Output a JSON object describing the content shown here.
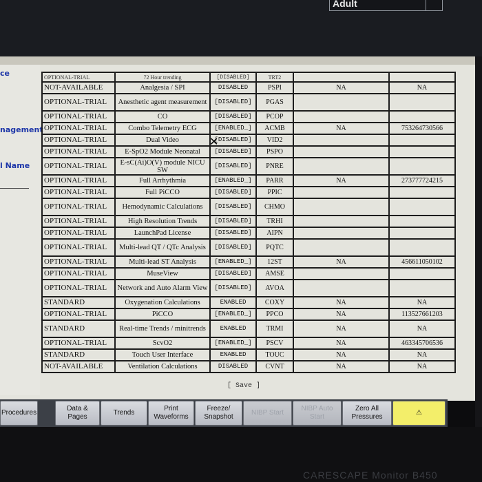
{
  "header": {
    "patient_type": "Adult"
  },
  "left_panel": {
    "labels": [
      "ce",
      "nagement",
      "l Name"
    ]
  },
  "table": {
    "rows": [
      {
        "status": "OPTIONAL-TRIAL",
        "feature": "72 Hour trending",
        "state": "[DISABLED]",
        "code": "TRT2",
        "v1": "",
        "v2": ""
      },
      {
        "status": "NOT-AVAILABLE",
        "feature": "Analgesia / SPI",
        "state": "DISABLED",
        "code": "PSPI",
        "v1": "NA",
        "v2": "NA"
      },
      {
        "status": "OPTIONAL-TRIAL",
        "feature": "Anesthetic agent measurement",
        "state": "[DISABLED]",
        "code": "PGAS",
        "v1": "",
        "v2": ""
      },
      {
        "status": "OPTIONAL-TRIAL",
        "feature": "CO",
        "state": "[DISABLED]",
        "code": "PCOP",
        "v1": "",
        "v2": ""
      },
      {
        "status": "OPTIONAL-TRIAL",
        "feature": "Combo Telemetry ECG",
        "state": "[ENABLED_]",
        "code": "ACMB",
        "v1": "NA",
        "v2": "753264730566"
      },
      {
        "status": "OPTIONAL-TRIAL",
        "feature": "Dual Video",
        "state": "[DISABLED]",
        "code": "VID2",
        "v1": "",
        "v2": ""
      },
      {
        "status": "OPTIONAL-TRIAL",
        "feature": "E-SpO2 Module Neonatal",
        "state": "[DISABLED]",
        "code": "PSPO",
        "v1": "",
        "v2": ""
      },
      {
        "status": "OPTIONAL-TRIAL",
        "feature": "E-sC(Ai)O(V) module NICU SW",
        "state": "[DISABLED]",
        "code": "PNRE",
        "v1": "",
        "v2": ""
      },
      {
        "status": "OPTIONAL-TRIAL",
        "feature": "Full Arrhythmia",
        "state": "[ENABLED_]",
        "code": "PARR",
        "v1": "NA",
        "v2": "273777724215"
      },
      {
        "status": "OPTIONAL-TRIAL",
        "feature": "Full PiCCO",
        "state": "[DISABLED]",
        "code": "PPIC",
        "v1": "",
        "v2": ""
      },
      {
        "status": "OPTIONAL-TRIAL",
        "feature": "Hemodynamic Calculations",
        "state": "[DISABLED]",
        "code": "CHMO",
        "v1": "",
        "v2": ""
      },
      {
        "status": "OPTIONAL-TRIAL",
        "feature": "High Resolution Trends",
        "state": "[DISABLED]",
        "code": "TRHI",
        "v1": "",
        "v2": ""
      },
      {
        "status": "OPTIONAL-TRIAL",
        "feature": "LaunchPad License",
        "state": "[DISABLED]",
        "code": "AIPN",
        "v1": "",
        "v2": ""
      },
      {
        "status": "OPTIONAL-TRIAL",
        "feature": "Multi-lead QT / QTc Analysis",
        "state": "[DISABLED]",
        "code": "PQTC",
        "v1": "",
        "v2": ""
      },
      {
        "status": "OPTIONAL-TRIAL",
        "feature": "Multi-lead ST Analysis",
        "state": "[ENABLED_]",
        "code": "12ST",
        "v1": "NA",
        "v2": "456611050102"
      },
      {
        "status": "OPTIONAL-TRIAL",
        "feature": "MuseView",
        "state": "[DISABLED]",
        "code": "AMSE",
        "v1": "",
        "v2": ""
      },
      {
        "status": "OPTIONAL-TRIAL",
        "feature": "Network and Auto Alarm View",
        "state": "[DISABLED]",
        "code": "AVOA",
        "v1": "",
        "v2": ""
      },
      {
        "status": "STANDARD",
        "feature": "Oxygenation Calculations",
        "state": "ENABLED",
        "code": "COXY",
        "v1": "NA",
        "v2": "NA"
      },
      {
        "status": "OPTIONAL-TRIAL",
        "feature": "PiCCO",
        "state": "[ENABLED_]",
        "code": "PPCO",
        "v1": "NA",
        "v2": "113527661203"
      },
      {
        "status": "STANDARD",
        "feature": "Real-time Trends / minitrends",
        "state": "ENABLED",
        "code": "TRMI",
        "v1": "NA",
        "v2": "NA"
      },
      {
        "status": "OPTIONAL-TRIAL",
        "feature": "ScvO2",
        "state": "[ENABLED_]",
        "code": "PSCV",
        "v1": "NA",
        "v2": "463345706536"
      },
      {
        "status": "STANDARD",
        "feature": "Touch User Interface",
        "state": "ENABLED",
        "code": "TOUC",
        "v1": "NA",
        "v2": "NA"
      },
      {
        "status": "NOT-AVAILABLE",
        "feature": "Ventilation Calculations",
        "state": "DISABLED",
        "code": "CVNT",
        "v1": "NA",
        "v2": "NA"
      }
    ]
  },
  "save_label": "[ Save ]",
  "buttons": [
    {
      "label": "Procedures",
      "enabled": true
    },
    {
      "label": "Data & Pages",
      "enabled": true
    },
    {
      "label": "Trends",
      "enabled": true
    },
    {
      "label": "Print Waveforms",
      "enabled": true
    },
    {
      "label": "Freeze/ Snapshot",
      "enabled": true
    },
    {
      "label": "NIBP Start",
      "enabled": false
    },
    {
      "label": "NIBP Auto Start",
      "enabled": false
    },
    {
      "label": "Zero All Pressures",
      "enabled": true
    },
    {
      "label": "⚠",
      "enabled": true
    }
  ],
  "brand": "CARESCAPE Monitor B450",
  "colors": {
    "screen_bg": "#e4e4dd",
    "left_label": "#1d36a8",
    "alarm_button": "#f3ee6a"
  }
}
